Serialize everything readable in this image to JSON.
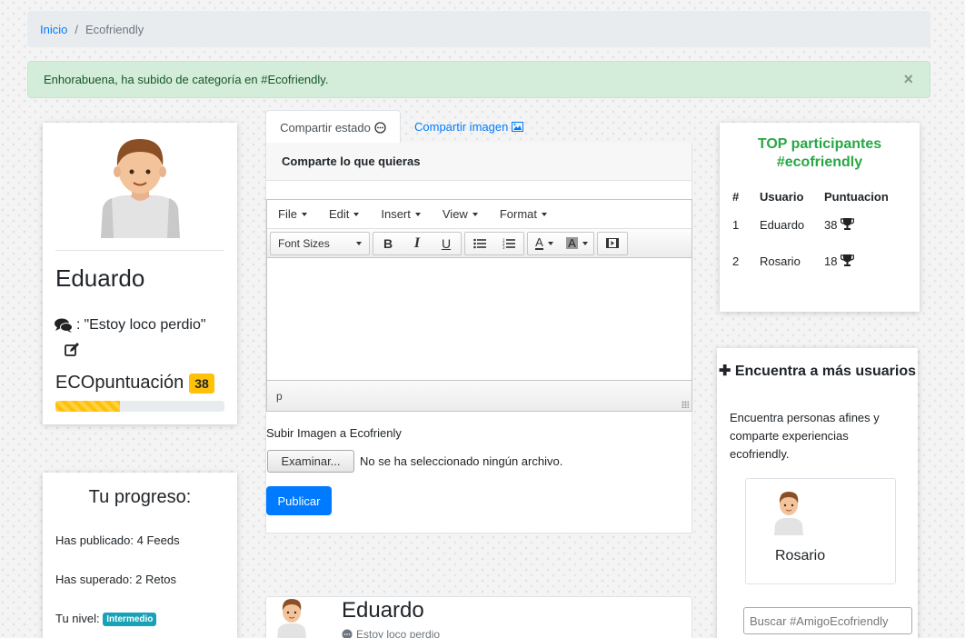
{
  "breadcrumb": {
    "home": "Inicio",
    "separator": "/",
    "current": "Ecofriendly"
  },
  "alert": {
    "message": "Enhorabuena, ha subido de categoría en #Ecofriendly.",
    "close": "×"
  },
  "profile": {
    "name": "Eduardo",
    "status_prefix": ":",
    "status": "\"Estoy loco perdio\"",
    "eco_label": "ECOpuntuación",
    "eco_score": "38",
    "progress_fraction": 0.38
  },
  "progreso": {
    "title": "Tu progreso:",
    "published": "Has publicado: 4 Feeds",
    "challenges": "Has superado: 2 Retos",
    "level_label": "Tu nivel:",
    "level": "Intermedio"
  },
  "tabs": [
    {
      "label": "Compartir estado",
      "icon": "chat-bubble-icon"
    },
    {
      "label": "Compartir imagen",
      "icon": "image-icon"
    }
  ],
  "share": {
    "header": "Comparte lo que quieras",
    "menu": [
      "File",
      "Edit",
      "Insert",
      "View",
      "Format"
    ],
    "font_sizes": "Font Sizes",
    "toolbar_icons": [
      "bold-icon",
      "italic-icon",
      "underline-icon",
      "bullet-list-icon",
      "numbered-list-icon",
      "text-color-icon",
      "background-color-icon",
      "media-icon"
    ],
    "status_path": "p",
    "upload_label": "Subir Imagen a Ecofrienly",
    "file_button": "Examinar...",
    "file_text": "No se ha seleccionado ningún archivo.",
    "publish": "Publicar"
  },
  "post": {
    "name": "Eduardo",
    "status": "Estoy loco perdio"
  },
  "top": {
    "title_line1": "TOP participantes",
    "title_line2": "#ecofriendly",
    "headers": [
      "#",
      "Usuario",
      "Puntuacion"
    ],
    "rows": [
      {
        "pos": "1",
        "user": "Eduardo",
        "score": "38"
      },
      {
        "pos": "2",
        "user": "Rosario",
        "score": "18"
      }
    ]
  },
  "find": {
    "plus": "✚",
    "title": "Encuentra a más usuarios",
    "desc": "Encuentra personas afines y comparte experiencias ecofriendly.",
    "user": "Rosario",
    "search_placeholder": "Buscar #AmigoEcofriendly"
  },
  "colors": {
    "primary": "#007bff",
    "success": "#28a745",
    "warning": "#ffc107",
    "info": "#17a2b8",
    "alert_bg": "#d4edda"
  }
}
